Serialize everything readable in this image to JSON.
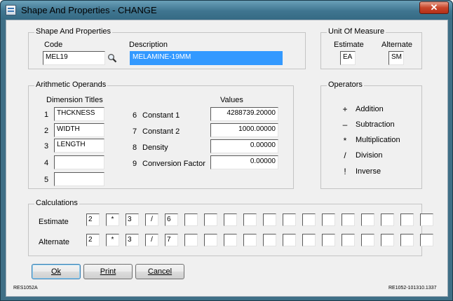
{
  "window": {
    "title": "Shape And Properties - CHANGE",
    "close_label": "✕"
  },
  "shape": {
    "group_title": "Shape And Properties",
    "code_label": "Code",
    "code_value": "MEL19",
    "description_label": "Description",
    "description_value": "MELAMINE-19MM"
  },
  "uom": {
    "group_title": "Unit Of Measure",
    "estimate_label": "Estimate",
    "estimate_value": "EA",
    "alternate_label": "Alternate",
    "alternate_value": "SM"
  },
  "arith": {
    "group_title": "Arithmetic Operands",
    "dim_header": "Dimension Titles",
    "values_header": "Values",
    "dimensions": [
      {
        "num": "1",
        "value": "THCKNESS"
      },
      {
        "num": "2",
        "value": "WIDTH"
      },
      {
        "num": "3",
        "value": "LENGTH"
      },
      {
        "num": "4",
        "value": ""
      },
      {
        "num": "5",
        "value": ""
      }
    ],
    "constants": [
      {
        "num": "6",
        "label": "Constant 1",
        "value": "4288739.20000"
      },
      {
        "num": "7",
        "label": "Constant 2",
        "value": "1000.00000"
      },
      {
        "num": "8",
        "label": "Density",
        "value": "0.00000"
      },
      {
        "num": "9",
        "label": "Conversion Factor",
        "value": "0.00000"
      }
    ]
  },
  "operators": {
    "group_title": "Operators",
    "items": [
      {
        "symbol": "+",
        "label": "Addition"
      },
      {
        "symbol": "–",
        "label": "Subtraction"
      },
      {
        "symbol": "*",
        "label": "Multiplication"
      },
      {
        "symbol": "/",
        "label": "Division"
      },
      {
        "symbol": "!",
        "label": "Inverse"
      }
    ]
  },
  "calc": {
    "group_title": "Calculations",
    "estimate_label": "Estimate",
    "alternate_label": "Alternate",
    "estimate_cells": [
      "2",
      "*",
      "3",
      "/",
      "6",
      "",
      "",
      "",
      "",
      "",
      "",
      "",
      "",
      "",
      "",
      "",
      "",
      ""
    ],
    "alternate_cells": [
      "2",
      "*",
      "3",
      "/",
      "7",
      "",
      "",
      "",
      "",
      "",
      "",
      "",
      "",
      "",
      "",
      "",
      "",
      ""
    ]
  },
  "buttons": {
    "ok": "Ok",
    "print": "Print",
    "cancel": "Cancel"
  },
  "footer": {
    "left": "RES1052A",
    "right": "RE1052-101310.1337"
  }
}
